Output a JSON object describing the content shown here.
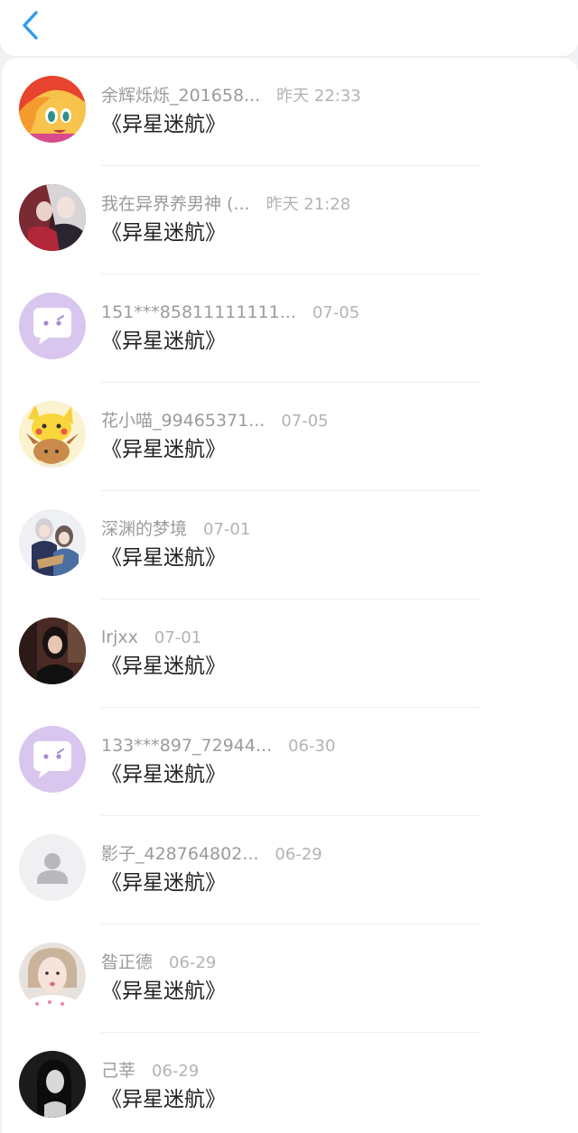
{
  "header": {
    "back_icon": "chevron-left-icon",
    "accent_color": "#2d9cf0"
  },
  "items": [
    {
      "name": "余辉烁烁_201658...",
      "time": "昨天 22:33",
      "title": "《异星迷航》",
      "avatar": "anime-pony-avatar"
    },
    {
      "name": "我在异界养男神 (...",
      "time": "昨天 21:28",
      "title": "《异星迷航》",
      "avatar": "anime-couple-avatar"
    },
    {
      "name": "151***85811111111...",
      "time": "07-05",
      "title": "《异星迷航》",
      "avatar": "chat-bubble-avatar"
    },
    {
      "name": "花小喵_99465371...",
      "time": "07-05",
      "title": "《异星迷航》",
      "avatar": "pikachu-eevee-avatar"
    },
    {
      "name": "深渊的梦境",
      "time": "07-01",
      "title": "《异星迷航》",
      "avatar": "anime-characters-avatar"
    },
    {
      "name": "lrjxx",
      "time": "07-01",
      "title": "《异星迷航》",
      "avatar": "woman-photo-avatar"
    },
    {
      "name": "133***897_72944...",
      "time": "06-30",
      "title": "《异星迷航》",
      "avatar": "chat-bubble-avatar"
    },
    {
      "name": "影子_428764802...",
      "time": "06-29",
      "title": "《异星迷航》",
      "avatar": "default-user-avatar"
    },
    {
      "name": "昝正德",
      "time": "06-29",
      "title": "《异星迷航》",
      "avatar": "girl-photo-avatar"
    },
    {
      "name": "己莘",
      "time": "06-29",
      "title": "《异星迷航》",
      "avatar": "bw-portrait-avatar"
    }
  ]
}
